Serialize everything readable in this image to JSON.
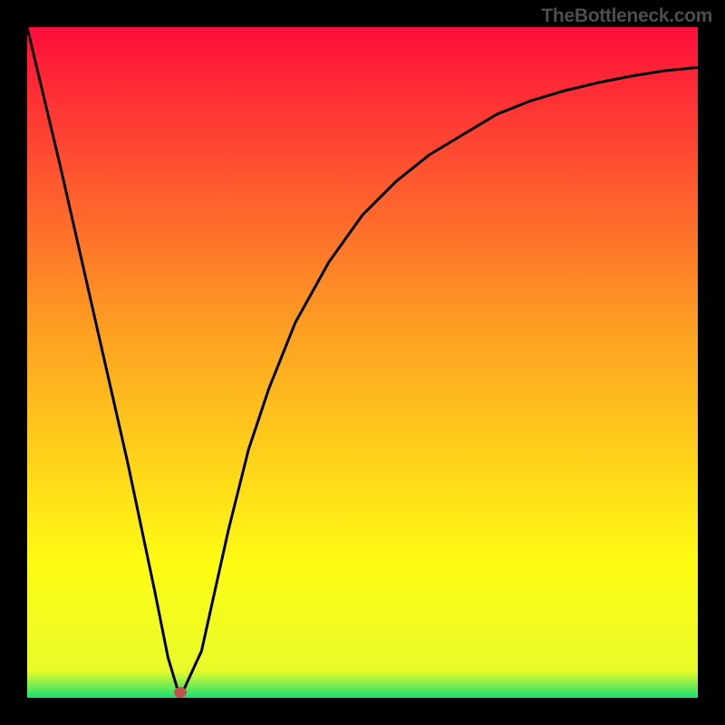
{
  "attribution": "TheBottleneck.com",
  "colors": {
    "top": "#fe0e3a",
    "mid_upper": "#fd9f22",
    "mid_lower": "#fefc13",
    "bottom": "#18e174",
    "curve": "#000000",
    "marker": "#c0544a",
    "frame": "#000000",
    "attribution_text": "#4d4d4d"
  },
  "marker": {
    "x_frac": 0.228,
    "y_frac": 0.992
  },
  "chart_data": {
    "type": "line",
    "title": "",
    "xlabel": "",
    "ylabel": "",
    "xlim": [
      0,
      1
    ],
    "ylim": [
      0,
      1
    ],
    "note": "Axes unlabeled; x and y expressed as fractions of plot width/height (0 = left/bottom, 1 = right/top). Curve values estimated from pixel positions.",
    "series": [
      {
        "name": "bottleneck-curve",
        "x": [
          0.0,
          0.05,
          0.1,
          0.15,
          0.19,
          0.21,
          0.228,
          0.26,
          0.28,
          0.3,
          0.33,
          0.36,
          0.4,
          0.45,
          0.5,
          0.55,
          0.6,
          0.65,
          0.7,
          0.75,
          0.8,
          0.85,
          0.9,
          0.95,
          1.0
        ],
        "y": [
          1.0,
          0.79,
          0.57,
          0.35,
          0.16,
          0.06,
          0.0,
          0.07,
          0.16,
          0.25,
          0.37,
          0.46,
          0.56,
          0.65,
          0.72,
          0.77,
          0.81,
          0.84,
          0.87,
          0.89,
          0.905,
          0.917,
          0.927,
          0.935,
          0.94
        ]
      }
    ],
    "annotations": [
      {
        "type": "point",
        "name": "optimal-marker",
        "x": 0.228,
        "y": 0.008
      }
    ],
    "background_gradient": {
      "direction": "vertical",
      "stops": [
        {
          "pos": 0.0,
          "color": "#fe0e3a"
        },
        {
          "pos": 0.45,
          "color": "#fd9f22"
        },
        {
          "pos": 0.8,
          "color": "#fefc13"
        },
        {
          "pos": 0.96,
          "color": "#e8fb2a"
        },
        {
          "pos": 1.0,
          "color": "#18e174"
        }
      ]
    }
  }
}
